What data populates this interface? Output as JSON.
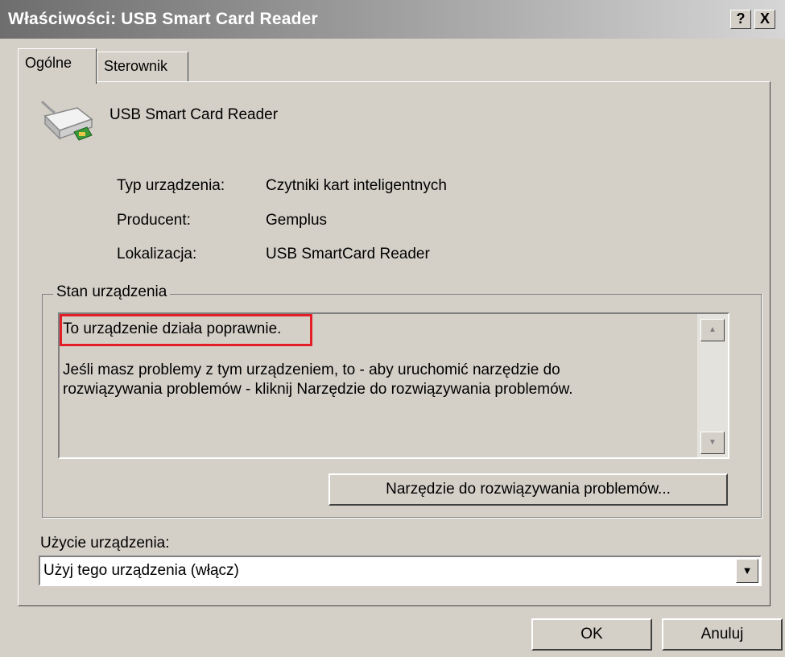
{
  "window": {
    "title": "Właściwości: USB Smart Card Reader",
    "help_label": "?",
    "close_label": "X"
  },
  "tabs": [
    {
      "label": "Ogólne",
      "active": true
    },
    {
      "label": "Sterownik",
      "active": false
    }
  ],
  "device": {
    "icon": "smart-card-reader-icon",
    "name": "USB Smart Card Reader",
    "properties": [
      {
        "label": "Typ urządzenia:",
        "value": "Czytniki kart inteligentnych"
      },
      {
        "label": "Producent:",
        "value": "Gemplus"
      },
      {
        "label": "Lokalizacja:",
        "value": "USB SmartCard Reader"
      }
    ]
  },
  "status": {
    "group_label": "Stan urządzenia",
    "status_text": "To urządzenie działa poprawnie.",
    "description": "Jeśli masz problemy z tym urządzeniem, to - aby uruchomić narzędzie do rozwiązywania problemów - kliknij Narzędzie do rozwiązywania problemów.",
    "troubleshoot_button": "Narzędzie do rozwiązywania problemów...",
    "highlight_color": "#e41e26"
  },
  "usage": {
    "label": "Użycie urządzenia:",
    "selected": "Użyj tego urządzenia (włącz)"
  },
  "footer": {
    "ok_label": "OK",
    "cancel_label": "Anuluj"
  }
}
